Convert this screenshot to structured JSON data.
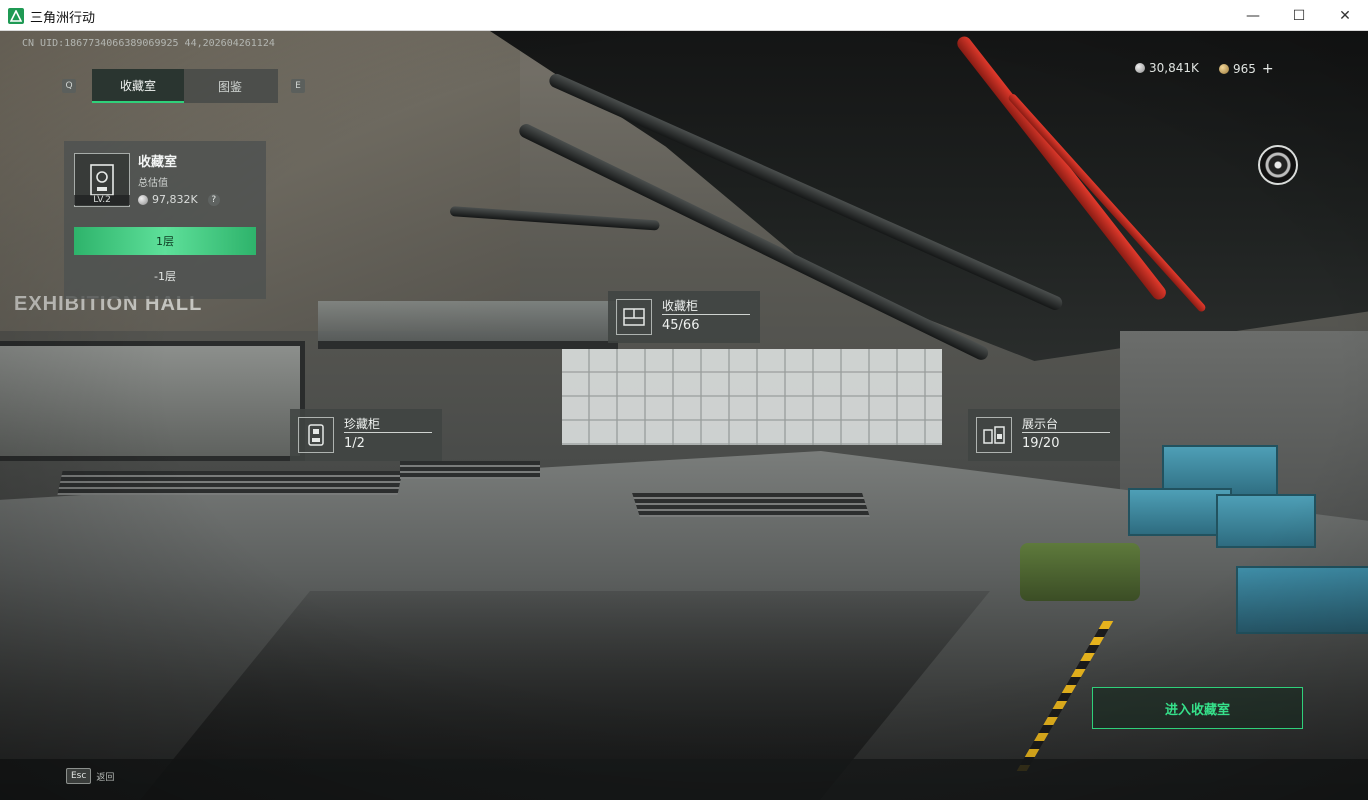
{
  "window": {
    "title": "三角洲行动"
  },
  "hud": {
    "uid": "CN UID:1867734066389069925 44,202604261124",
    "key_left": "Q",
    "key_right": "E",
    "tabs": [
      {
        "label": "收藏室",
        "active": true
      },
      {
        "label": "图鉴",
        "active": false
      }
    ],
    "currency_silver": "30,841K",
    "currency_gold": "965",
    "currency_plus": "+"
  },
  "room_card": {
    "title": "收藏室",
    "subtitle": "总估值",
    "value": "97,832K",
    "help": "?",
    "level": "LV.2",
    "floors": [
      {
        "label": "1层",
        "active": true
      },
      {
        "label": "-1层",
        "active": false
      }
    ]
  },
  "scene": {
    "sign": "EXHIBITION HALL"
  },
  "poi": {
    "cabinet": {
      "name": "收藏柜",
      "count": "45/66"
    },
    "treasure": {
      "name": "珍藏柜",
      "count": "1/2"
    },
    "display": {
      "name": "展示台",
      "count": "19/20"
    }
  },
  "actions": {
    "enter": "进入收藏室",
    "esc_key": "Esc",
    "esc_label": "返回"
  },
  "colors": {
    "accent": "#2fd07a",
    "pipe_red": "#e23a2c"
  }
}
